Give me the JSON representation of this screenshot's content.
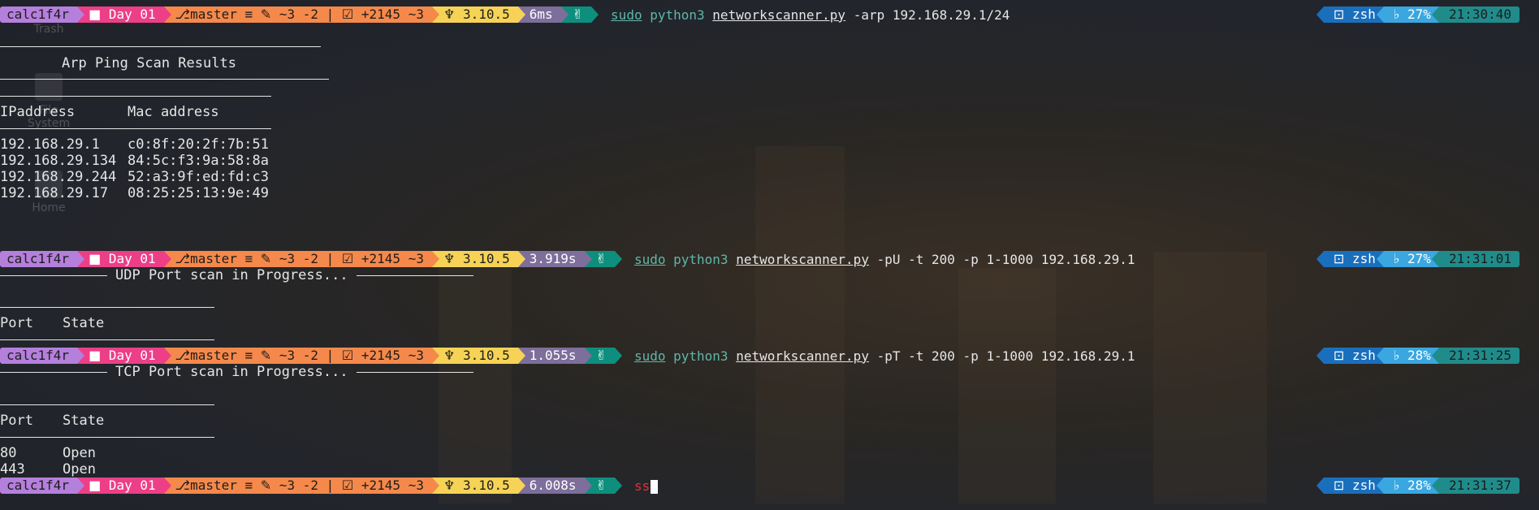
{
  "colors": {
    "user": "#b57fdc",
    "dir": "#ec3f87",
    "git": "#f5894b",
    "python": "#f6d356",
    "duration": "#7d6e9b",
    "status": "#0e8f7d",
    "shell": "#1a6fbd",
    "battery": "#3aa7e0",
    "clock": "#1f8c8b"
  },
  "desktop": {
    "trash_label": "Trash",
    "filesystem_label": "File System",
    "home_label": "Home"
  },
  "prompt": {
    "user": "calc1f4r",
    "dir_icon": "folder-icon",
    "dir": "Day 01",
    "git_icon": "git-branch-icon",
    "branch": "master",
    "git_equal": "≡",
    "edits_icon": "edit-icon",
    "edits": "~3 -2",
    "staged_icon": "check-square-icon",
    "staged": "+2145 ~3",
    "python_icon": "python-icon",
    "python_version": "3.10.5",
    "status_icon": "success-icon",
    "shell_icon": "terminal-icon",
    "shell": "zsh",
    "battery_icon": "battery-icon"
  },
  "prompts": [
    {
      "duration": "6ms",
      "cmd_sudo": "sudo",
      "cmd_python": "python3",
      "cmd_file": "networkscanner.py",
      "cmd_args": "-arp 192.168.29.1/24",
      "battery": "27%",
      "clock": "21:30:40"
    },
    {
      "duration": "3.919s",
      "cmd_sudo": "sudo",
      "cmd_python": "python3",
      "cmd_file": "networkscanner.py",
      "cmd_args": "-pU -t 200 -p 1-1000 192.168.29.1",
      "battery": "27%",
      "clock": "21:31:01"
    },
    {
      "duration": "1.055s",
      "cmd_sudo": "sudo",
      "cmd_python": "python3",
      "cmd_file": "networkscanner.py",
      "cmd_args": "-pT -t 200 -p 1-1000 192.168.29.1",
      "battery": "28%",
      "clock": "21:31:25"
    },
    {
      "duration": "6.008s",
      "typed": "ss",
      "battery": "28%",
      "clock": "21:31:37"
    }
  ],
  "arp": {
    "title": "Arp Ping Scan Results",
    "col_ip": "IPaddress",
    "col_mac": "Mac address",
    "rows": [
      {
        "ip": "192.168.29.1",
        "mac": "c0:8f:20:2f:7b:51"
      },
      {
        "ip": "192.168.29.134",
        "mac": "84:5c:f3:9a:58:8a"
      },
      {
        "ip": "192.168.29.244",
        "mac": "52:a3:9f:ed:fd:c3"
      },
      {
        "ip": "192.168.29.17",
        "mac": "08:25:25:13:9e:49"
      }
    ]
  },
  "udp": {
    "banner": "UDP Port scan in Progress...",
    "col_port": "Port",
    "col_state": "State"
  },
  "tcp": {
    "banner": "TCP Port scan in Progress...",
    "col_port": "Port",
    "col_state": "State",
    "rows": [
      {
        "port": "80",
        "state": "Open"
      },
      {
        "port": "443",
        "state": "Open"
      }
    ]
  }
}
